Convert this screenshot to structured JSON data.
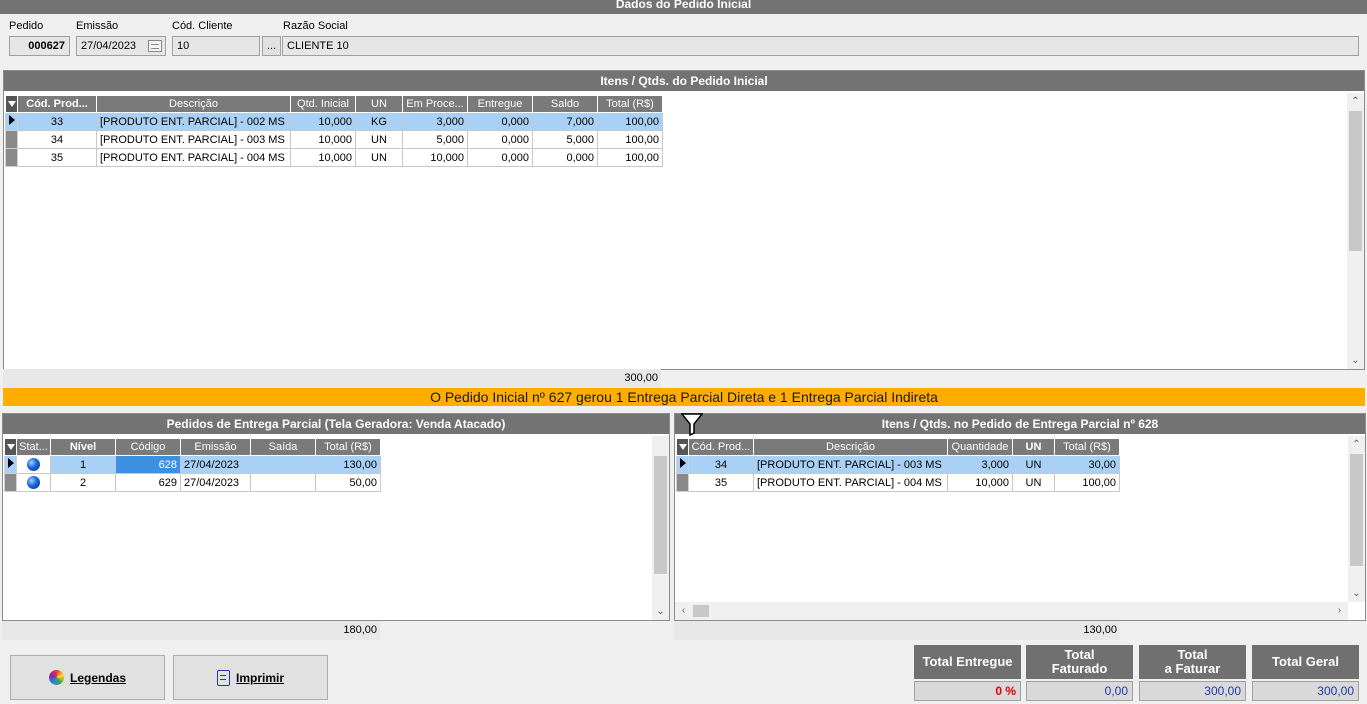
{
  "header": {
    "title": "Dados do Pedido Inicial"
  },
  "order": {
    "pedido_label": "Pedido",
    "pedido": "000627",
    "emissao_label": "Emissão",
    "emissao": "27/04/2023",
    "cliente_label": "Cód. Cliente",
    "cliente": "10",
    "ellipsis": "...",
    "razao_label": "Razão Social",
    "razao": "CLIENTE 10"
  },
  "items_panel": {
    "title": "Itens / Qtds. do Pedido Inicial",
    "columns": [
      "Cód. Prod...",
      "Descrição",
      "Qtd. Inicial",
      "UN",
      "Em Proce...",
      "Entregue",
      "Saldo",
      "Total (R$)"
    ],
    "rows": [
      [
        "33",
        "[PRODUTO ENT. PARCIAL] - 002 MS",
        "10,000",
        "KG",
        "3,000",
        "0,000",
        "7,000",
        "100,00"
      ],
      [
        "34",
        "[PRODUTO ENT. PARCIAL] - 003 MS",
        "10,000",
        "UN",
        "5,000",
        "0,000",
        "5,000",
        "100,00"
      ],
      [
        "35",
        "[PRODUTO ENT. PARCIAL] - 004 MS",
        "10,000",
        "UN",
        "10,000",
        "0,000",
        "0,000",
        "100,00"
      ]
    ],
    "total": "300,00"
  },
  "banner": "O Pedido Inicial nº 627 gerou 1 Entrega Parcial Direta e 1 Entrega Parcial Indireta",
  "partial_orders": {
    "title": "Pedidos de Entrega Parcial (Tela Geradora: Venda Atacado)",
    "columns": [
      "Stat...",
      "Nível",
      "Código",
      "Emissão",
      "Saída",
      "Total (R$)"
    ],
    "rows": [
      [
        "",
        "1",
        "628",
        "27/04/2023",
        "",
        "130,00"
      ],
      [
        "",
        "2",
        "629",
        "27/04/2023",
        "",
        "50,00"
      ]
    ],
    "total": "180,00"
  },
  "partial_items": {
    "title": "Itens / Qtds. no Pedido de Entrega Parcial nº 628",
    "columns": [
      "Cód. Prod...",
      "Descrição",
      "Quantidade",
      "UN",
      "Total (R$)"
    ],
    "rows": [
      [
        "34",
        "[PRODUTO ENT. PARCIAL] - 003 MS",
        "3,000",
        "UN",
        "30,00"
      ],
      [
        "35",
        "[PRODUTO ENT. PARCIAL] - 004 MS",
        "10,000",
        "UN",
        "100,00"
      ]
    ],
    "total": "130,00"
  },
  "buttons": {
    "legendas": "Legendas",
    "imprimir": "Imprimir"
  },
  "totals": {
    "entregue_label": "Total Entregue",
    "entregue": "0 %",
    "faturado_label1": "Total",
    "faturado_label2": "Faturado",
    "faturado": "0,00",
    "afaturar_label1": "Total",
    "afaturar_label2": "a Faturar",
    "afaturar": "300,00",
    "geral_label": "Total Geral",
    "geral": "300,00"
  },
  "colors": {
    "header": "#737373",
    "banner": "#ffae00",
    "selection": "#a9d1f5",
    "value_blue": "#1e3ca8",
    "value_red": "#e00000"
  }
}
